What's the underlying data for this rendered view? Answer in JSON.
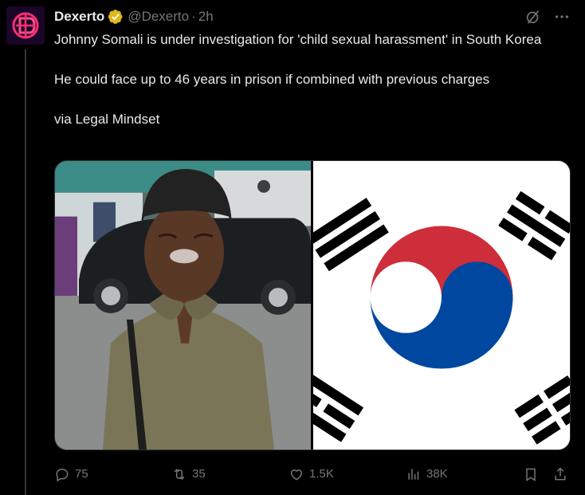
{
  "author": {
    "name": "Dexerto",
    "handle": "@Dexerto",
    "separator": "·",
    "time": "2h"
  },
  "tweet": {
    "paragraph1": "Johnny Somali is under investigation for 'child sexual harassment' in South Korea",
    "paragraph2": "He could face up to 46 years in prison if combined with previous charges",
    "paragraph3": "via Legal Mindset"
  },
  "icons": {
    "grok": "grok-icon",
    "more": "more-icon",
    "verified": "verified-badge-icon",
    "reply": "reply-icon",
    "retweet": "retweet-icon",
    "like": "like-icon",
    "views": "views-icon",
    "bookmark": "bookmark-icon",
    "share": "share-icon"
  },
  "stats": {
    "replies": "75",
    "retweets": "35",
    "likes": "1.5K",
    "views": "38K"
  },
  "colors": {
    "background": "#000000",
    "text": "#e7e9ea",
    "muted": "#71767b",
    "verified": "#e2b719",
    "flag_red": "#cd2e3a",
    "flag_blue": "#0047a0"
  }
}
